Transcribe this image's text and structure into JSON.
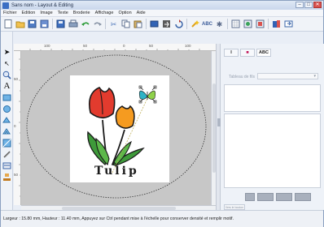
{
  "window": {
    "title": "Sans nom - Layout & Editing",
    "controls": [
      "–",
      "□",
      "✕"
    ]
  },
  "menu": [
    "Fichier",
    "Edition",
    "Image",
    "Texte",
    "Broderie",
    "Affichage",
    "Option",
    "Aide"
  ],
  "toolbar": {
    "icons": [
      "new-file-icon",
      "open-folder-icon",
      "save-as-icon",
      "print-preview-icon",
      "save-icon",
      "print-icon",
      "undo-icon",
      "redo-icon",
      "cut-icon",
      "copy-icon",
      "paste-icon",
      "import-icon",
      "transfer-icon",
      "rotate-icon",
      "magic-wand-icon",
      "text-abc-icon",
      "text-style-icon",
      "grid-icon",
      "design-center-icon",
      "settings-icon",
      "card-icon",
      "export-icon"
    ]
  },
  "left_tools": [
    "select-arrow-icon",
    "point-edit-icon",
    "zoom-icon",
    "text-a-icon",
    "outline-icon",
    "shape-circle-icon",
    "fill-icon",
    "stitch-icon",
    "pattern-icon",
    "applique-icon",
    "monogram-icon",
    "stamp-icon"
  ],
  "ruler": {
    "top_labels": [
      "100",
      "50",
      "0",
      "50",
      "100"
    ],
    "left_labels": [
      "50",
      "0",
      "50"
    ]
  },
  "design": {
    "text": "Tulip",
    "colors": {
      "red": "#e23b2e",
      "orange": "#f59b20",
      "green": "#3e9a3a",
      "dark": "#1a1a1a"
    }
  },
  "right_panel": {
    "tabs": [
      "I",
      "■",
      "ABC"
    ],
    "select_label": "Tableau de fils",
    "bottom_button": "Vers le bouton"
  },
  "status": {
    "text": "Largeur : 15.80 mm, Hauteur : 11.40 mm, Appuyez sur Ctrl pendant mise à l'échelle pour conserver densité et remplir motif."
  },
  "colors": {
    "window_bg": "#e9eef6",
    "canvas_bg": "#c7c7c7",
    "hoop_bg": "#ffffff",
    "accent": "#3b6fc4"
  }
}
